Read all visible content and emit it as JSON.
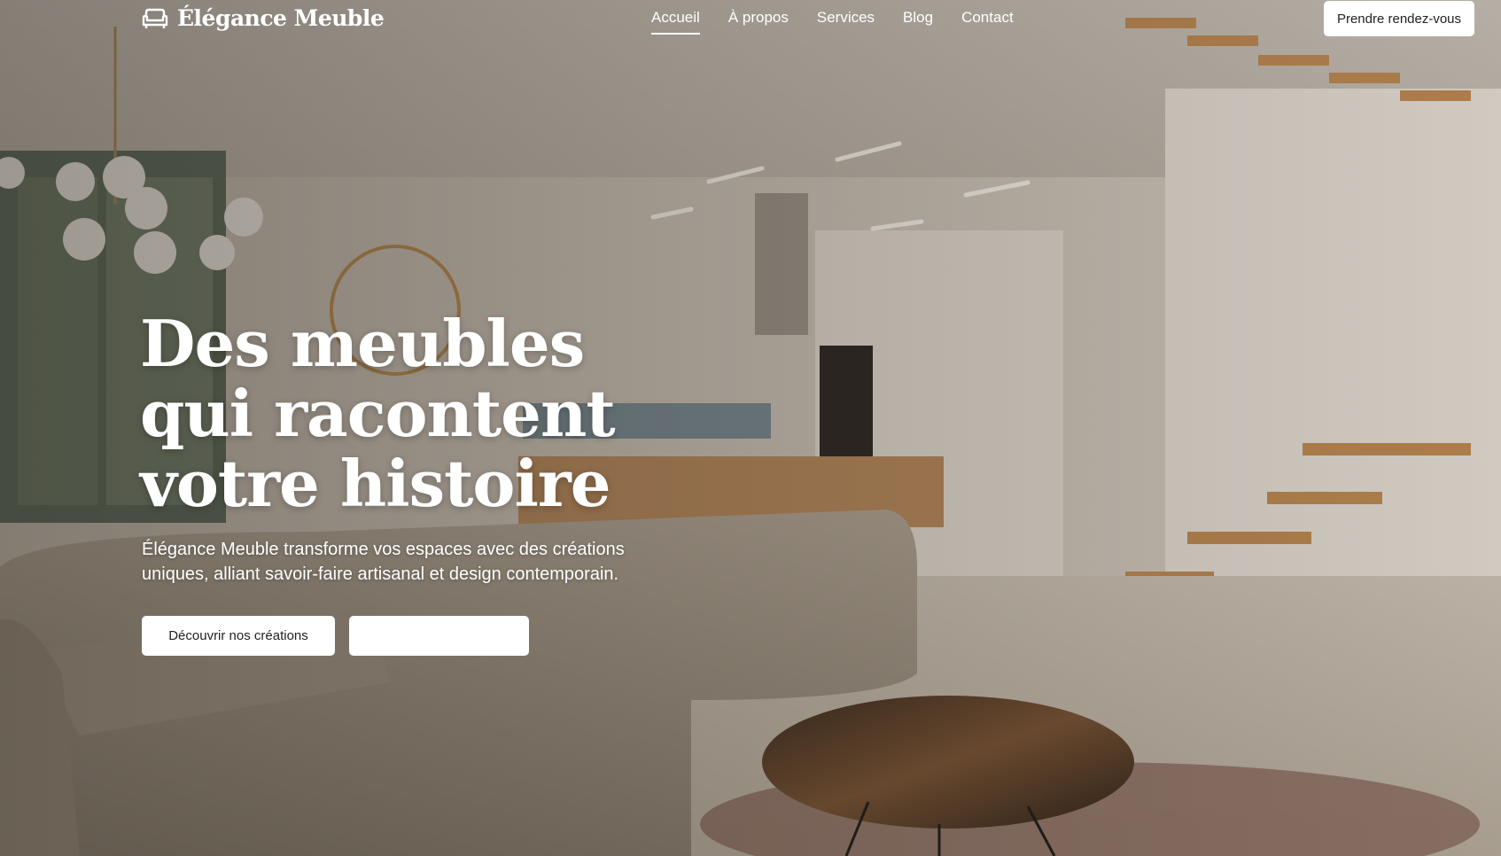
{
  "brand": {
    "name": "Élégance Meuble",
    "icon": "sofa-icon"
  },
  "nav": {
    "items": [
      {
        "label": "Accueil",
        "active": true
      },
      {
        "label": "À propos",
        "active": false
      },
      {
        "label": "Services",
        "active": false
      },
      {
        "label": "Blog",
        "active": false
      },
      {
        "label": "Contact",
        "active": false
      }
    ]
  },
  "header_cta": {
    "label": "Prendre rendez-vous"
  },
  "hero": {
    "headline": "Des meubles qui racontent votre histoire",
    "subtitle": "Élégance Meuble transforme vos espaces avec des créations uniques, alliant savoir-faire artisanal et design contemporain.",
    "primary_button": "Découvrir nos créations",
    "secondary_button": ""
  },
  "colors": {
    "text": "#ffffff",
    "button_bg": "#ffffff",
    "button_text": "#222222",
    "overlay": "#28221c"
  }
}
